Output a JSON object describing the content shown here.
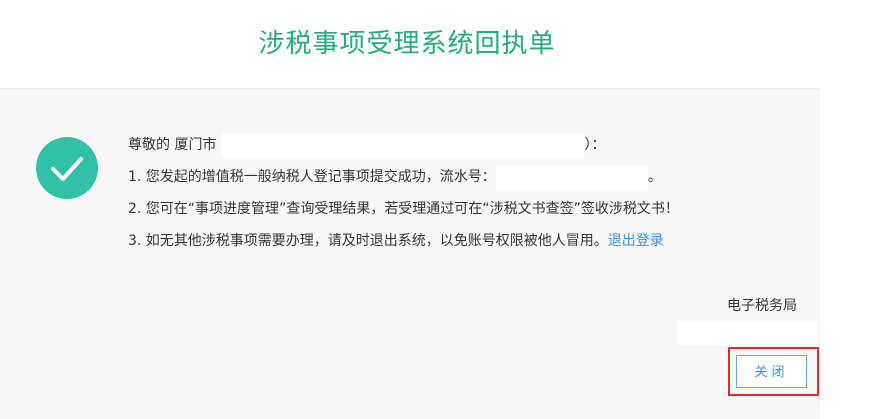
{
  "header": {
    "title": "涉税事项受理系统回执单"
  },
  "message": {
    "greeting_prefix": "尊敬的 厦门市",
    "greeting_suffix": "）：",
    "line1_text": "1. 您发起的增值税一般纳税人登记事项提交成功，流水号：",
    "line1_end": "。",
    "line2_text": "2. 您可在“事项进度管理”查询受理结果，若受理通过可在“涉税文书查签”签收涉税文书！",
    "line3_text": "3. 如无其他涉税事项需要办理，请及时退出系统，以免账号权限被他人冒用。",
    "logout_link": "退出登录"
  },
  "footer": {
    "bureau": "电子税务局",
    "close_label": "关闭"
  },
  "icons": {
    "status": "check-circle-icon"
  },
  "colors": {
    "title": "#25a980",
    "check_circle": "#31c2a6",
    "link": "#3b8fd8",
    "button_border": "#5fa9dc",
    "highlight": "#e32b2b"
  }
}
